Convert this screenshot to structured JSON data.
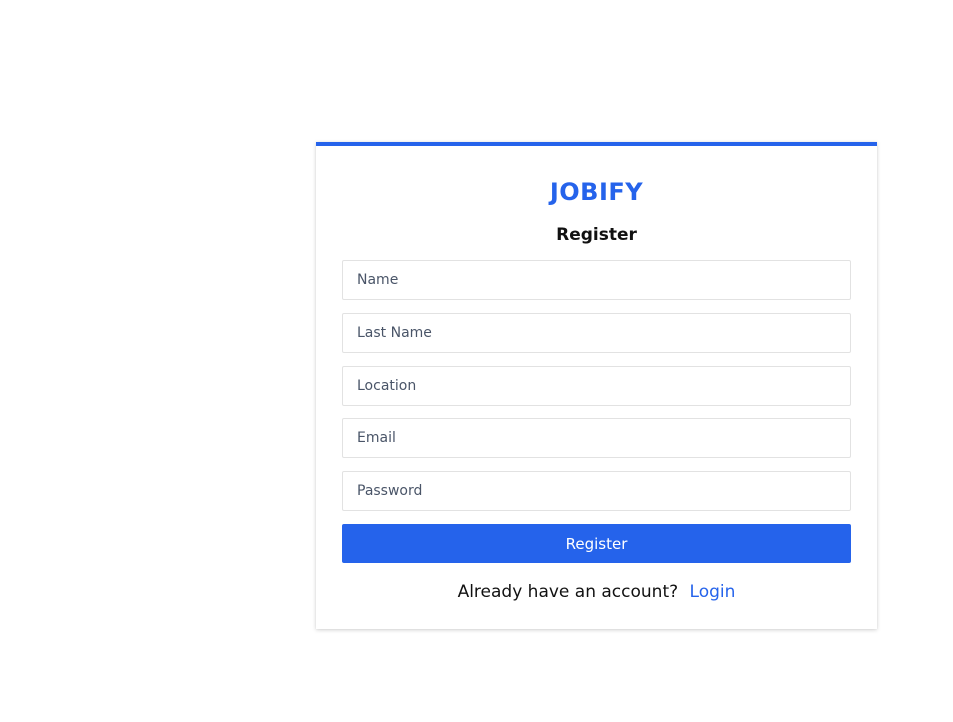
{
  "brand": {
    "logo_text": "JOBIFY",
    "accent_color": "#2563eb"
  },
  "form": {
    "title": "Register",
    "fields": [
      {
        "name": "name",
        "placeholder": "Name",
        "value": ""
      },
      {
        "name": "last-name",
        "placeholder": "Last Name",
        "value": ""
      },
      {
        "name": "location",
        "placeholder": "Location",
        "value": ""
      },
      {
        "name": "email",
        "placeholder": "Email",
        "value": ""
      },
      {
        "name": "password",
        "placeholder": "Password",
        "value": ""
      }
    ],
    "submit_label": "Register"
  },
  "footer": {
    "prompt": "Already have an account?",
    "link_label": "Login"
  }
}
